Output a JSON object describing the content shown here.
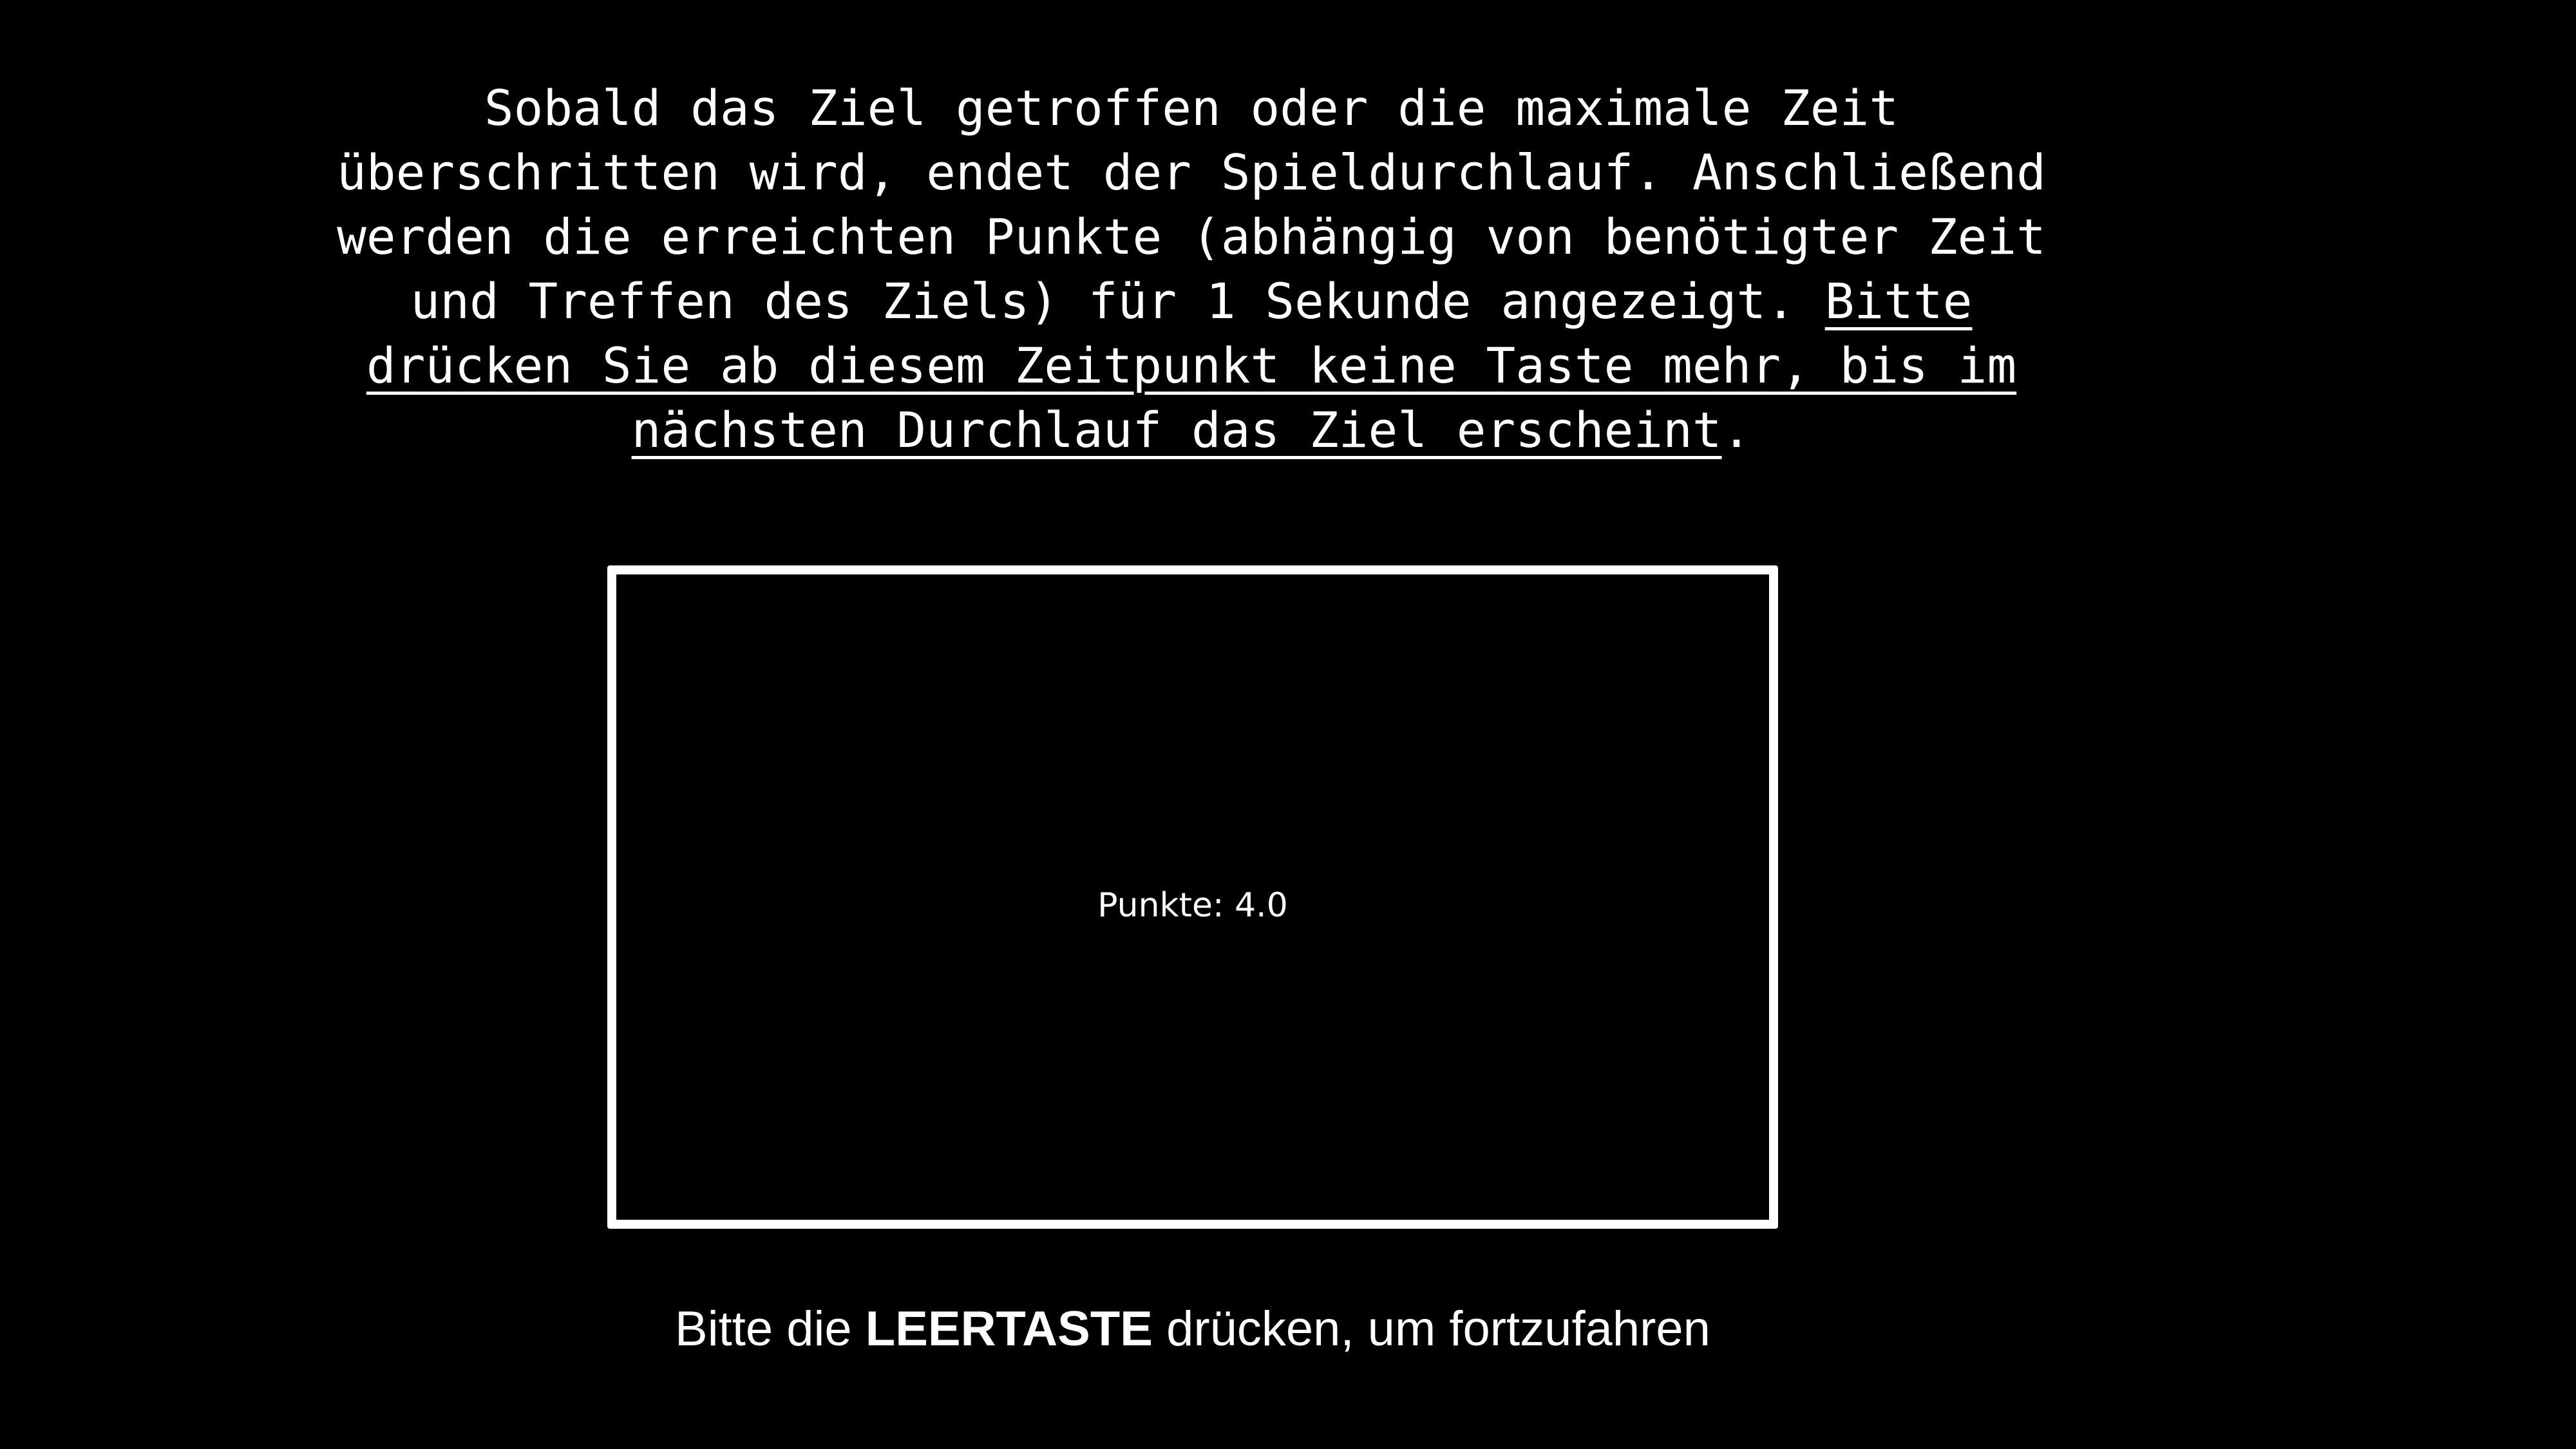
{
  "instructions": {
    "text": "Sobald das Ziel getroffen oder die maximale Zeit überschritten wird, endet der Spieldurchlauf. Anschließend werden die erreichten Punkte (abhängig von benötigter Zeit und Treffen des Ziels) für 1 Sekunde angezeigt. ",
    "warning": "Bitte drücken Sie ab diesem Zeitpunkt keine Taste mehr, bis im nächsten Durchlauf das Ziel erscheint",
    "end": "."
  },
  "game": {
    "score_text": "Punkte: 4.0"
  },
  "prompt": {
    "before": "Bitte die ",
    "key": "LEERTASTE",
    "after": " drücken, um fortzufahren"
  },
  "colors": {
    "background": "#000000",
    "text": "#ffffff",
    "frame_border": "#ffffff"
  }
}
